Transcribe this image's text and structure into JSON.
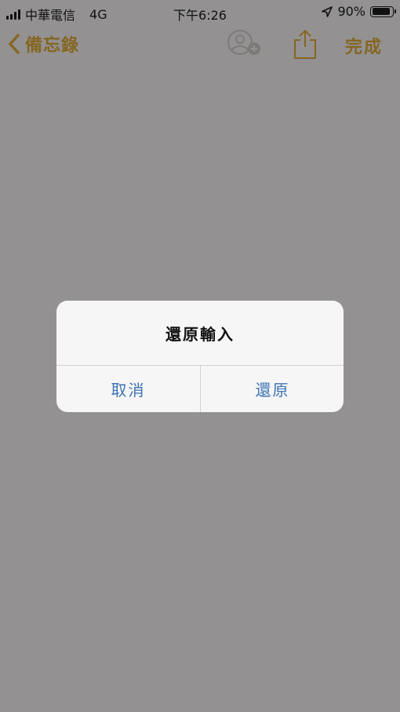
{
  "status_bar": {
    "carrier": "中華電信",
    "network": "4G",
    "time": "下午6:26",
    "battery": "90%",
    "battery_level": 0.9,
    "icons": [
      "signal-bars-icon",
      "location-arrow-icon",
      "battery-icon"
    ]
  },
  "nav": {
    "back_label": "備忘錄",
    "done_label": "完成",
    "icons": [
      "chevron-left-icon",
      "add-collaborator-icon",
      "share-icon"
    ]
  },
  "alert": {
    "title": "還原輸入",
    "cancel_label": "取消",
    "confirm_label": "還原"
  },
  "colors": {
    "accent": "#856623",
    "alert_button": "#3b73b3",
    "background": "#939191",
    "alert_background": "#f6f6f6"
  }
}
